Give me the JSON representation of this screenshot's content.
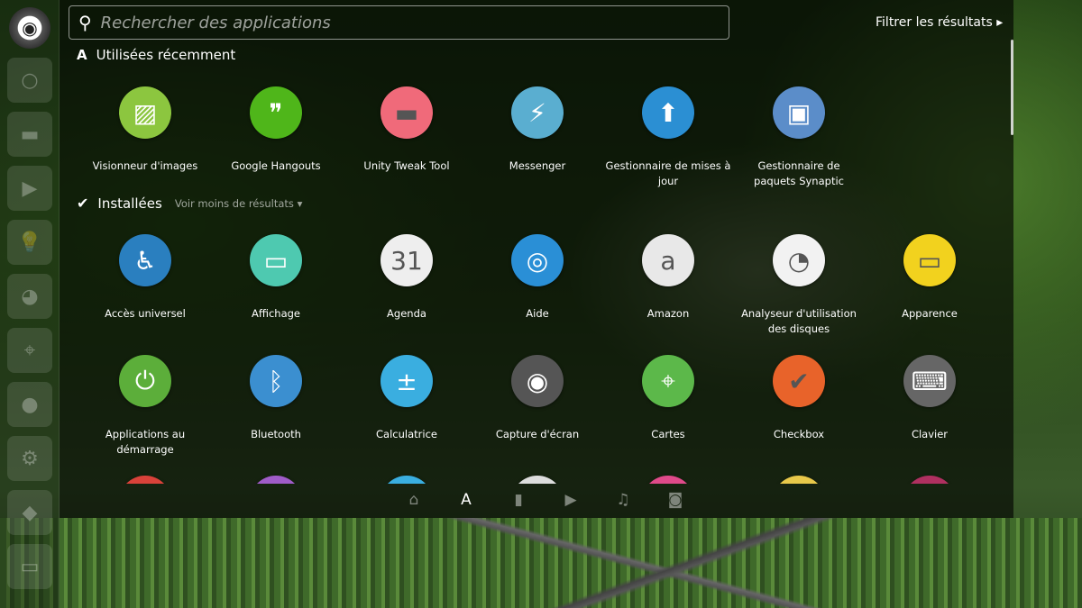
{
  "launcher": {
    "items": [
      "ubuntu-logo",
      "circle",
      "folder",
      "play",
      "bulb",
      "face",
      "map",
      "camera",
      "gear",
      "controller",
      "window"
    ]
  },
  "search": {
    "placeholder": "Rechercher des applications"
  },
  "filter": {
    "label": "Filtrer les résultats ▸"
  },
  "recent": {
    "title": "Utilisées récemment",
    "apps": [
      {
        "label": "Visionneur d'images",
        "color": "#8cc63f",
        "glyph": "▨"
      },
      {
        "label": "Google Hangouts",
        "color": "#4fb61a",
        "glyph": "❞"
      },
      {
        "label": "Unity Tweak Tool",
        "color": "#f06a7a",
        "glyph": "▬"
      },
      {
        "label": "Messenger",
        "color": "#5aaed0",
        "glyph": "⚡"
      },
      {
        "label": "Gestionnaire de mises à jour",
        "color": "#2b8fd3",
        "glyph": "⬆"
      },
      {
        "label": "Gestionnaire de paquets Synaptic",
        "color": "#5b8dc9",
        "glyph": "▣"
      }
    ]
  },
  "installed": {
    "title": "Installées",
    "toggle": "Voir moins de résultats ▾",
    "apps": [
      {
        "label": "Accès universel",
        "color": "#2a7fbf",
        "glyph": "♿"
      },
      {
        "label": "Affichage",
        "color": "#4ec9b0",
        "glyph": "▭"
      },
      {
        "label": "Agenda",
        "color": "#eeeeee",
        "glyph": "31"
      },
      {
        "label": "Aide",
        "color": "#2a8fd6",
        "glyph": "◎"
      },
      {
        "label": "Amazon",
        "color": "#e8e8e8",
        "glyph": "a"
      },
      {
        "label": "Analyseur d'utilisation des disques",
        "color": "#f2f2f2",
        "glyph": "◔"
      },
      {
        "label": "Apparence",
        "color": "#f2d21e",
        "glyph": "▭"
      },
      {
        "label": "Applications au démarrage",
        "color": "#5cae3a",
        "glyph": "⏻"
      },
      {
        "label": "Bluetooth",
        "color": "#3b8fd0",
        "glyph": "ᛒ"
      },
      {
        "label": "Calculatrice",
        "color": "#3aaee0",
        "glyph": "±"
      },
      {
        "label": "Capture d'écran",
        "color": "#555555",
        "glyph": "◉"
      },
      {
        "label": "Cartes",
        "color": "#5cb84a",
        "glyph": "⌖"
      },
      {
        "label": "Checkbox",
        "color": "#e8632a",
        "glyph": "✔"
      },
      {
        "label": "Clavier",
        "color": "#666666",
        "glyph": "⌨"
      }
    ],
    "partial_colors": [
      "#d9423a",
      "#a05cc8",
      "#3aaee0",
      "#dddddd",
      "#e04a8a",
      "#e8c84a",
      "#b03060"
    ]
  },
  "lenses": [
    {
      "name": "home",
      "glyph": "⌂"
    },
    {
      "name": "applications",
      "glyph": "A",
      "active": true
    },
    {
      "name": "files",
      "glyph": "▮"
    },
    {
      "name": "video",
      "glyph": "▶"
    },
    {
      "name": "music",
      "glyph": "♫"
    },
    {
      "name": "photos",
      "glyph": "◙"
    }
  ]
}
